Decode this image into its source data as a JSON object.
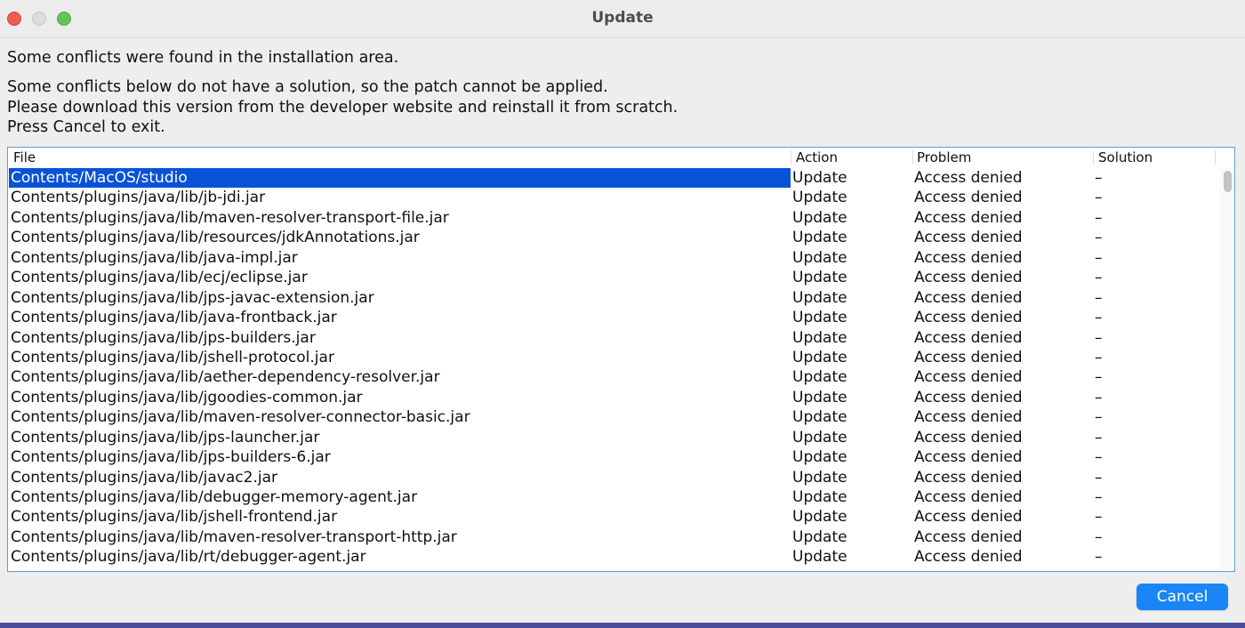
{
  "window": {
    "title": "Update"
  },
  "messages": {
    "line1": "Some conflicts were found in the installation area.",
    "line2": "Some conflicts below do not have a solution, so the patch cannot be applied.",
    "line3": "Please download this version from the developer website and reinstall it from scratch.",
    "line4": "Press Cancel to exit."
  },
  "table": {
    "headers": [
      "File",
      "Action",
      "Problem",
      "Solution"
    ],
    "selected_index": 0,
    "rows": [
      {
        "file": "Contents/MacOS/studio",
        "action": "Update",
        "problem": "Access denied",
        "solution": "–"
      },
      {
        "file": "Contents/plugins/java/lib/jb-jdi.jar",
        "action": "Update",
        "problem": "Access denied",
        "solution": "–"
      },
      {
        "file": "Contents/plugins/java/lib/maven-resolver-transport-file.jar",
        "action": "Update",
        "problem": "Access denied",
        "solution": "–"
      },
      {
        "file": "Contents/plugins/java/lib/resources/jdkAnnotations.jar",
        "action": "Update",
        "problem": "Access denied",
        "solution": "–"
      },
      {
        "file": "Contents/plugins/java/lib/java-impl.jar",
        "action": "Update",
        "problem": "Access denied",
        "solution": "–"
      },
      {
        "file": "Contents/plugins/java/lib/ecj/eclipse.jar",
        "action": "Update",
        "problem": "Access denied",
        "solution": "–"
      },
      {
        "file": "Contents/plugins/java/lib/jps-javac-extension.jar",
        "action": "Update",
        "problem": "Access denied",
        "solution": "–"
      },
      {
        "file": "Contents/plugins/java/lib/java-frontback.jar",
        "action": "Update",
        "problem": "Access denied",
        "solution": "–"
      },
      {
        "file": "Contents/plugins/java/lib/jps-builders.jar",
        "action": "Update",
        "problem": "Access denied",
        "solution": "–"
      },
      {
        "file": "Contents/plugins/java/lib/jshell-protocol.jar",
        "action": "Update",
        "problem": "Access denied",
        "solution": "–"
      },
      {
        "file": "Contents/plugins/java/lib/aether-dependency-resolver.jar",
        "action": "Update",
        "problem": "Access denied",
        "solution": "–"
      },
      {
        "file": "Contents/plugins/java/lib/jgoodies-common.jar",
        "action": "Update",
        "problem": "Access denied",
        "solution": "–"
      },
      {
        "file": "Contents/plugins/java/lib/maven-resolver-connector-basic.jar",
        "action": "Update",
        "problem": "Access denied",
        "solution": "–"
      },
      {
        "file": "Contents/plugins/java/lib/jps-launcher.jar",
        "action": "Update",
        "problem": "Access denied",
        "solution": "–"
      },
      {
        "file": "Contents/plugins/java/lib/jps-builders-6.jar",
        "action": "Update",
        "problem": "Access denied",
        "solution": "–"
      },
      {
        "file": "Contents/plugins/java/lib/javac2.jar",
        "action": "Update",
        "problem": "Access denied",
        "solution": "–"
      },
      {
        "file": "Contents/plugins/java/lib/debugger-memory-agent.jar",
        "action": "Update",
        "problem": "Access denied",
        "solution": "–"
      },
      {
        "file": "Contents/plugins/java/lib/jshell-frontend.jar",
        "action": "Update",
        "problem": "Access denied",
        "solution": "–"
      },
      {
        "file": "Contents/plugins/java/lib/maven-resolver-transport-http.jar",
        "action": "Update",
        "problem": "Access denied",
        "solution": "–"
      },
      {
        "file": "Contents/plugins/java/lib/rt/debugger-agent.jar",
        "action": "Update",
        "problem": "Access denied",
        "solution": "–"
      }
    ]
  },
  "buttons": {
    "cancel": "Cancel"
  },
  "colors": {
    "selection": "#0753d8",
    "accent_button": "#1a86f6",
    "table_border": "#5aa1db",
    "close": "#ee5c52",
    "zoom": "#62c554"
  }
}
